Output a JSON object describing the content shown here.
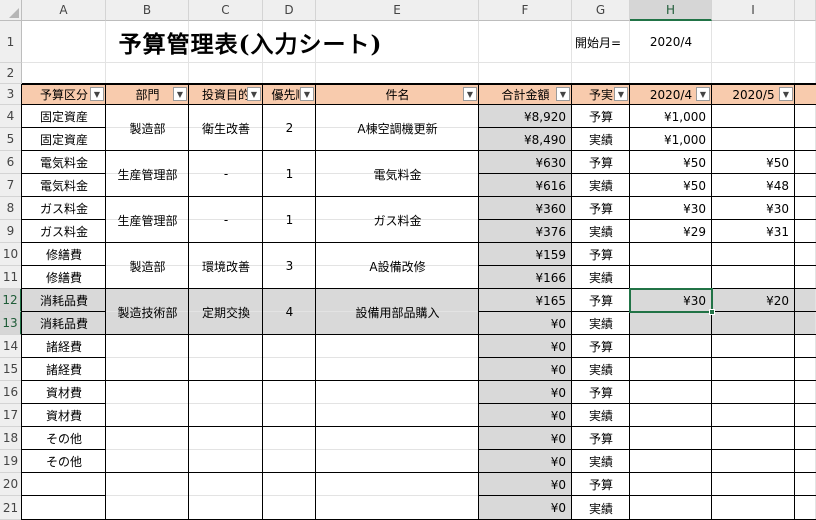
{
  "columns": [
    "A",
    "B",
    "C",
    "D",
    "E",
    "F",
    "G",
    "H",
    "I"
  ],
  "rows": [
    "1",
    "2",
    "3",
    "4",
    "5",
    "6",
    "7",
    "8",
    "9",
    "10",
    "11",
    "12",
    "13",
    "14",
    "15",
    "16",
    "17",
    "18",
    "19",
    "20",
    "21"
  ],
  "title": "予算管理表(入力シート)",
  "start_label": "開始月=",
  "start_value": "2020/4",
  "headers": {
    "category": "予算区分",
    "dept": "部門",
    "purpose": "投資目的",
    "priority": "優先順",
    "subject": "件名",
    "total": "合計金額",
    "type": "予実",
    "m1": "2020/4",
    "m2": "2020/5"
  },
  "category_col": [
    "固定資産",
    "固定資産",
    "電気料金",
    "電気料金",
    "ガス料金",
    "ガス料金",
    "修繕費",
    "修繕費",
    "消耗品費",
    "消耗品費",
    "諸経費",
    "諸経費",
    "資材費",
    "資材費",
    "その他",
    "その他",
    "",
    ""
  ],
  "groups": [
    {
      "dept": "製造部",
      "purpose": "衛生改善",
      "priority": "2",
      "subject": "A棟空調機更新"
    },
    {
      "dept": "生産管理部",
      "purpose": "-",
      "priority": "1",
      "subject": "電気料金"
    },
    {
      "dept": "生産管理部",
      "purpose": "-",
      "priority": "1",
      "subject": "ガス料金"
    },
    {
      "dept": "製造部",
      "purpose": "環境改善",
      "priority": "3",
      "subject": "A設備改修"
    },
    {
      "dept": "製造技術部",
      "purpose": "定期交換",
      "priority": "4",
      "subject": "設備用部品購入"
    }
  ],
  "totals": [
    "¥8,920",
    "¥8,490",
    "¥630",
    "¥616",
    "¥360",
    "¥376",
    "¥159",
    "¥166",
    "¥165",
    "¥0",
    "¥0",
    "¥0",
    "¥0",
    "¥0",
    "¥0",
    "¥0",
    "¥0",
    "¥0"
  ],
  "types": [
    "予算",
    "実績",
    "予算",
    "実績",
    "予算",
    "実績",
    "予算",
    "実績",
    "予算",
    "実績",
    "予算",
    "実績",
    "予算",
    "実績",
    "予算",
    "実績",
    "予算",
    "実績"
  ],
  "m1": [
    "¥1,000",
    "¥1,000",
    "¥50",
    "¥50",
    "¥30",
    "¥29",
    "",
    "",
    "¥30",
    "",
    "",
    "",
    "",
    "",
    "",
    "",
    "",
    ""
  ],
  "m2": [
    "",
    "",
    "¥50",
    "¥48",
    "¥30",
    "¥31",
    "",
    "",
    "¥20",
    "",
    "",
    "",
    "",
    "",
    "",
    "",
    "",
    ""
  ]
}
